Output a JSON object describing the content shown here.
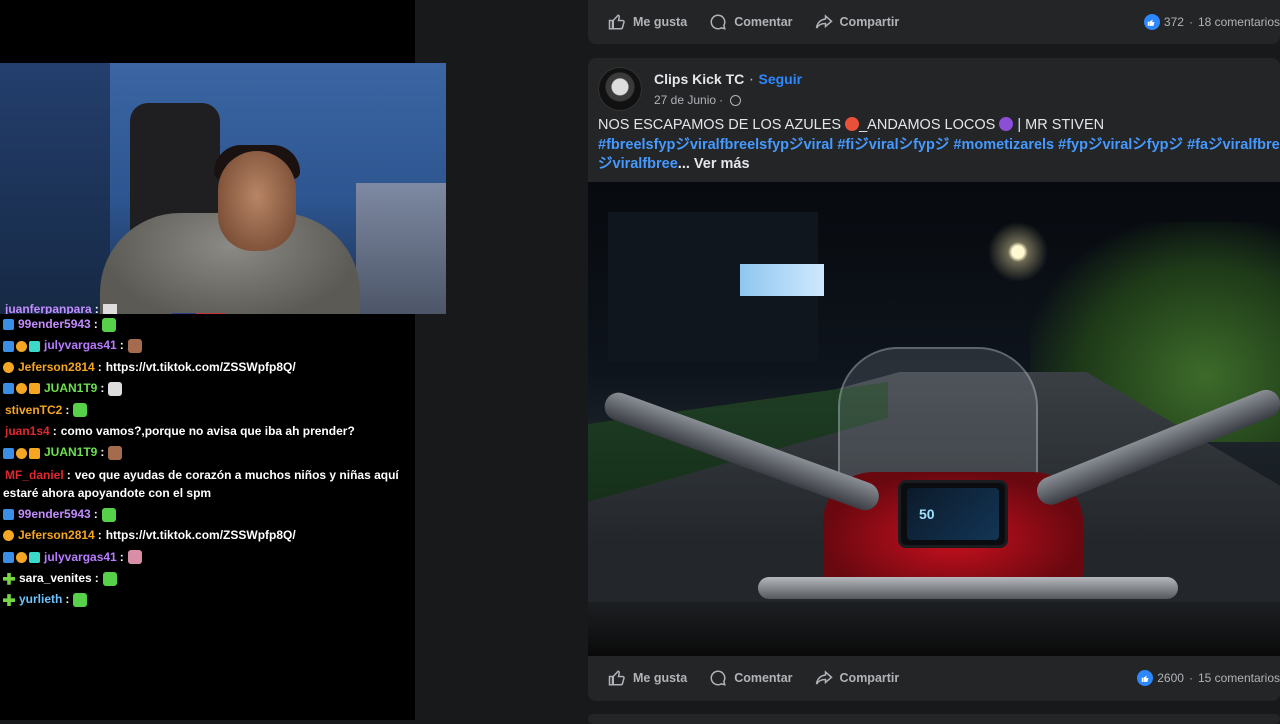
{
  "chat": {
    "messages": [
      {
        "user": "juanferpanpara",
        "color": "#c38cff",
        "badges": [],
        "text": "",
        "emote": "e-white",
        "partial": true
      },
      {
        "user": "99ender5943",
        "color": "#c38cff",
        "badges": [
          "b-mod"
        ],
        "text": "",
        "emote": "e-green"
      },
      {
        "user": "julyvargas41",
        "color": "#b77cff",
        "badges": [
          "b-mod",
          "b-sub",
          "b-vip"
        ],
        "text": "",
        "emote": "e-brown"
      },
      {
        "user": "Jeferson2814",
        "color": "#f5a623",
        "badges": [
          "b-sub"
        ],
        "text": "https://vt.tiktok.com/ZSSWpfp8Q/",
        "emote": ""
      },
      {
        "user": "JUAN1T9",
        "color": "#6de04d",
        "badges": [
          "b-mod",
          "b-sub",
          "b-gift"
        ],
        "text": "",
        "emote": "e-white"
      },
      {
        "user": "stivenTC2",
        "color": "#f5a623",
        "badges": [],
        "text": "",
        "emote": "e-green"
      },
      {
        "user": "juan1s4",
        "color": "#e0282e",
        "badges": [],
        "text": "como vamos?,porque no avisa que iba ah prender?",
        "emote": ""
      },
      {
        "user": "JUAN1T9",
        "color": "#6de04d",
        "badges": [
          "b-mod",
          "b-sub",
          "b-gift"
        ],
        "text": "",
        "emote": "e-brown"
      },
      {
        "user": "MF_daniel",
        "color": "#e0282e",
        "badges": [],
        "text": "veo que ayudas de corazón a muchos niños y niñas aquí estaré ahora apoyandote con el spm",
        "emote": "",
        "wrap": true
      },
      {
        "user": "99ender5943",
        "color": "#c38cff",
        "badges": [
          "b-mod"
        ],
        "text": "",
        "emote": "e-green"
      },
      {
        "user": "Jeferson2814",
        "color": "#f5a623",
        "badges": [
          "b-sub"
        ],
        "text": "https://vt.tiktok.com/ZSSWpfp8Q/",
        "emote": ""
      },
      {
        "user": "julyvargas41",
        "color": "#b77cff",
        "badges": [
          "b-mod",
          "b-sub",
          "b-vip"
        ],
        "text": "",
        "emote": "e-pink"
      },
      {
        "user": "sara_venites",
        "color": "#ffffff",
        "badges": [
          "b-plus"
        ],
        "text": "",
        "emote": "e-green"
      },
      {
        "user": "yurlieth",
        "color": "#6fc3ff",
        "badges": [
          "b-plus"
        ],
        "text": "",
        "emote": "e-green"
      }
    ]
  },
  "post1": {
    "like_label": "Me gusta",
    "comment_label": "Comentar",
    "share_label": "Compartir",
    "reactions": "372",
    "comments": "18 comentarios"
  },
  "post2": {
    "page_name": "Clips Kick TC",
    "follow_label": "Seguir",
    "separator": "·",
    "date": "27 de Junio",
    "caption_title_a": "NOS ESCAPAMOS DE LOS AZULES ",
    "caption_title_b": "_ANDAMOS LOCOS ",
    "caption_title_c": " | MR STIVEN",
    "hashtags_line1": "#fbreelsfypジviralfbreelsfypジviral #fiジviralシfypジ #mometizarels #fypジviralシfypジ #faジviralfbre",
    "hashtags_line2": "ジviralfbree",
    "see_more": "... Ver más",
    "dash_speed": "50",
    "like_label": "Me gusta",
    "comment_label": "Comentar",
    "share_label": "Compartir",
    "reactions": "2600",
    "comments": "15 comentarios"
  },
  "colors": {
    "accent": "#2d88ff",
    "hashtag": "#4599ff",
    "feed_bg": "#18191a",
    "card_bg": "#242526"
  }
}
